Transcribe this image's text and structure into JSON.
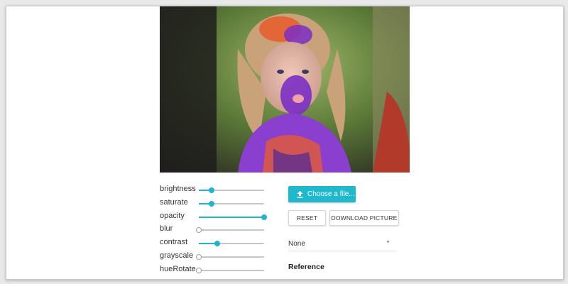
{
  "photo": {
    "description_icon": "girl-holi-colors-photo",
    "accent_colors": [
      "#7b2fc4",
      "#e85d2a",
      "#2b2b2b",
      "#8ab84a"
    ]
  },
  "sliders": [
    {
      "label": "brightness",
      "value": 0.2
    },
    {
      "label": "saturate",
      "value": 0.2
    },
    {
      "label": "opacity",
      "value": 1.0
    },
    {
      "label": "blur",
      "value": 0.0
    },
    {
      "label": "contrast",
      "value": 0.28
    },
    {
      "label": "grayscale",
      "value": 0.0
    },
    {
      "label": "hueRotate",
      "value": 0.0
    }
  ],
  "controls": {
    "choose_file_label": "Choose a file...",
    "reset_label": "RESET",
    "download_label": "DOWNLOAD PICTURE",
    "filter_select_value": "None",
    "reference_label": "Reference"
  },
  "colors": {
    "accent": "#1fb5cf",
    "track": "#c6c6c6"
  }
}
